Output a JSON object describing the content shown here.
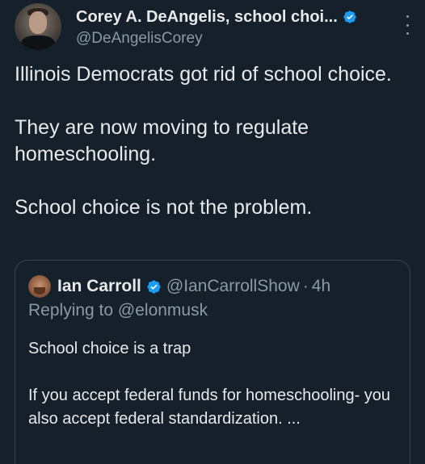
{
  "tweet": {
    "author_name": "Corey A. DeAngelis, school choi...",
    "author_handle": "@DeAngelisCorey",
    "verified_color": "#1d9bf0",
    "text": "Illinois Democrats got rid of school choice.\n\nThey are now moving to regulate homeschooling.\n\nSchool choice is not the problem."
  },
  "quoted": {
    "author_name": "Ian Carroll",
    "author_handle": "@IanCarrollShow",
    "separator": "·",
    "time": "4h",
    "reply_prefix": "Replying to ",
    "reply_to": "@elonmusk",
    "text": "School choice is a trap\n\nIf you accept federal funds for homeschooling- you also accept federal standardization. ..."
  },
  "icons": {
    "verified": "verified-badge-icon",
    "more": "more-options-icon"
  }
}
